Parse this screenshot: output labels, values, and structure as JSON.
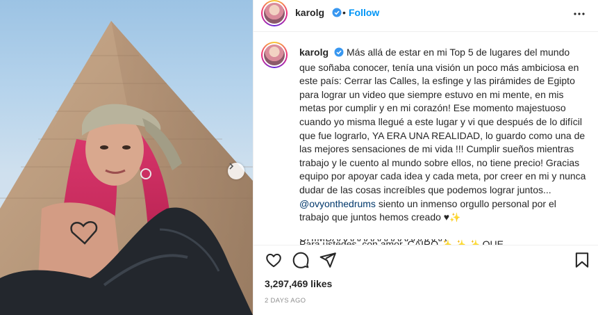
{
  "post": {
    "username": "karolg",
    "follow_label": "Follow",
    "separator": "•",
    "icons": {
      "verified": "verified-badge-icon",
      "more": "more-options-icon",
      "carousel_next": "chevron-right-icon",
      "like": "heart-icon",
      "comment": "comment-icon",
      "share": "paper-plane-icon",
      "save": "bookmark-icon"
    },
    "colors": {
      "accent": "#0095f6",
      "verified": "#3897f0",
      "mention": "#00376b",
      "text": "#262626",
      "muted": "#8e8e8e"
    }
  },
  "caption": {
    "username": "karolg",
    "text_part1": "Más allá de estar en mi Top 5 de lugares del mundo que soñaba conocer, tenía una visión un poco más ambiciosa en este país: Cerrar las Calles, la esfinge y las pirámides de Egipto para lograr un video que siempre estuvo en mi mente, en mis metas por cumplir y en mi corazón! Ese momento majestuoso cuando yo misma llegué a este lugar y vi que después de lo difícil que fue lograrlo, YA ERA UNA REALIDAD, lo guardo como una de las mejores sensaciones de mi vida !!! Cumplir sueños mientras trabajo y le cuento al mundo sobre ellos, no tiene precio! Gracias equipo por apoyar cada idea y cada meta, por creer en mi y nunca dudar de las cosas increíbles que podemos lograr juntos...",
    "mention": "@ovyonthedrums",
    "text_part2": "siento un inmenso orgullo personal por el trabajo que juntos hemos creado ♥",
    "sparkle_after_heart": "✨",
    "closing_lead": "Para ustedes, con amor, CAIRO",
    "closing_sparkles": "✨ ✨ ✨",
    "closing_tail": "QUE",
    "cut_line": "CHIMBAAAAAAAAAAAAAAAAA UFFFFFFFFFFFF!!!!!!!!!!!!!!!!!!!!!!!! ???"
  },
  "stats": {
    "likes": "3,297,469 likes",
    "timestamp": "2 DAYS AGO"
  }
}
